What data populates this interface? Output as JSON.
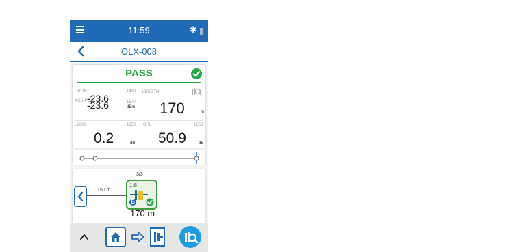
{
  "status_bar": {
    "time": "11:59",
    "bluetooth_icon": "✱"
  },
  "header": {
    "title": "OLX-008"
  },
  "result": {
    "verdict": "PASS",
    "gpon": {
      "label": "GPON",
      "value": "-23.6",
      "wavelength": "1490"
    },
    "xgspon": {
      "label": "XGS-PON",
      "value": "-23.6",
      "wavelength": "1577",
      "unit": "dBm"
    },
    "length": {
      "label": "LENGTH",
      "value": "170",
      "unit": "m"
    },
    "loss": {
      "label": "LOSS",
      "wavelength": "1650",
      "value": "0.2",
      "unit": "dB"
    },
    "orl": {
      "label": "ORL",
      "wavelength": "1650",
      "value": "50.9",
      "unit": "dB"
    }
  },
  "trace": {
    "counter": "3/3",
    "segment_length": "150 m",
    "element_ratio": "1:8",
    "element_badge": "B",
    "element_distance": "170 m"
  },
  "colors": {
    "primary": "#1f6bb6",
    "pass": "#28a745",
    "element_border": "#3e9a3e",
    "splitter": "#e6c12a"
  },
  "icons": [
    "menu-icon",
    "bluetooth-icon",
    "battery-icon",
    "back-icon",
    "check-circle-icon",
    "magnifier-icon",
    "chevron-up-icon",
    "home-icon",
    "arrow-right-icon",
    "element-icon",
    "zoom-fiber-icon"
  ]
}
